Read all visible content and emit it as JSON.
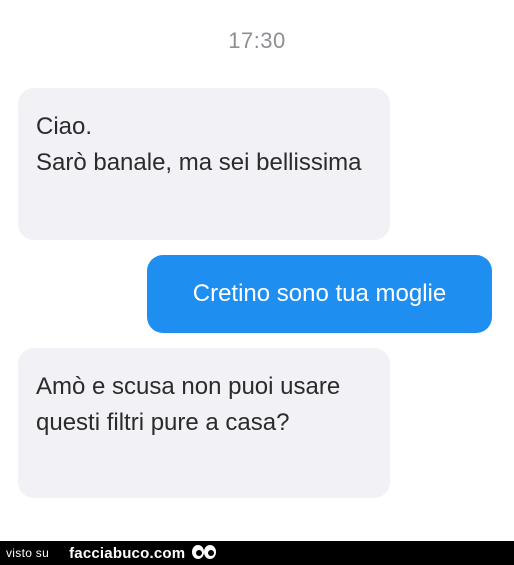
{
  "chat": {
    "timestamp": "17:30",
    "messages": [
      {
        "direction": "incoming",
        "text": "Ciao.\nSarò banale, ma sei bellissima"
      },
      {
        "direction": "outgoing",
        "text": "Cretino sono tua moglie"
      },
      {
        "direction": "incoming",
        "text": "Amò e scusa non puoi usare questi filtri pure a casa?"
      }
    ]
  },
  "watermark": {
    "prefix": "visto su",
    "site": "facciabuco.com",
    "icon": "eyes-logo-icon"
  },
  "colors": {
    "background": "#ffffff",
    "incoming_bubble": "#f1f1f6",
    "outgoing_bubble": "#1f8ef1",
    "timestamp_text": "#8e8e93",
    "footer_bar": "#000000"
  }
}
